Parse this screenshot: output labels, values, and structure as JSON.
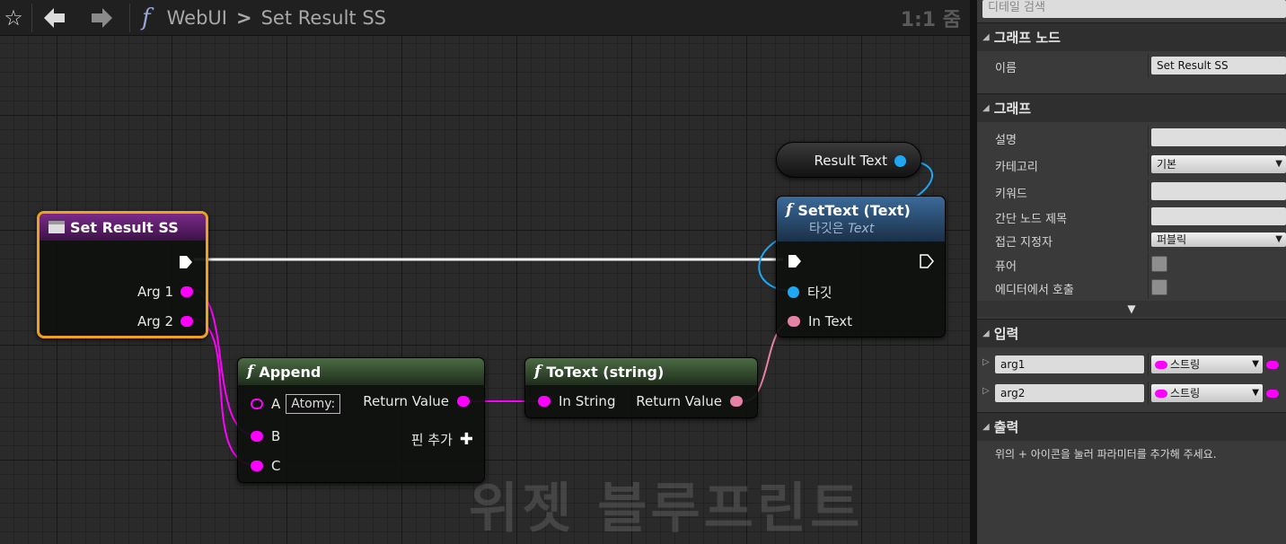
{
  "toolbar": {
    "breadcrumb": {
      "parent": "WebUI",
      "separator": ">",
      "current": "Set Result SS"
    },
    "zoom_label": "1:1 줌",
    "icons": [
      "star-icon",
      "back-arrow-icon",
      "forward-arrow-icon",
      "function-icon"
    ]
  },
  "watermark": "위젯 블루프린트",
  "nodes": {
    "set_result": {
      "title": "Set Result SS",
      "pins": [
        "Arg 1",
        "Arg 2"
      ]
    },
    "append": {
      "title": "Append",
      "pin_a": "A",
      "a_default": "Atomy:",
      "pin_b": "B",
      "pin_c": "C",
      "return": "Return Value",
      "add_pin": "핀 추가"
    },
    "totext": {
      "title": "ToText (string)",
      "in": "In String",
      "return": "Return Value"
    },
    "settext": {
      "title": "SetText (Text)",
      "subtitle_prefix": "타깃은",
      "subtitle_target": "Text",
      "target": "타깃",
      "in_text": "In Text"
    },
    "variable": {
      "label": "Result Text"
    }
  },
  "panel": {
    "search_placeholder": "디테일 검색",
    "section_graph_node": "그래프 노드",
    "name_label": "이름",
    "name_value": "Set Result SS",
    "section_graph": "그래프",
    "fields": {
      "description": "설명",
      "category": "카테고리",
      "category_value": "기본",
      "keywords": "키워드",
      "compact_title": "간단 노드 제목",
      "access": "접근 지정자",
      "access_value": "퍼블릭",
      "pure": "퓨어",
      "call_in_editor": "에디터에서 호출"
    },
    "section_inputs": "입력",
    "inputs": [
      {
        "name": "arg1",
        "type": "스트링"
      },
      {
        "name": "arg2",
        "type": "스트링"
      }
    ],
    "section_outputs": "출력",
    "outputs_hint": "위의 + 아이콘을 눌러 파라미터를 추가해 주세요."
  },
  "colors": {
    "string_pin": "#ff00ff",
    "text_pin": "#e582a6",
    "object_pin": "#1ea7f4",
    "selection": "#f0a020"
  }
}
